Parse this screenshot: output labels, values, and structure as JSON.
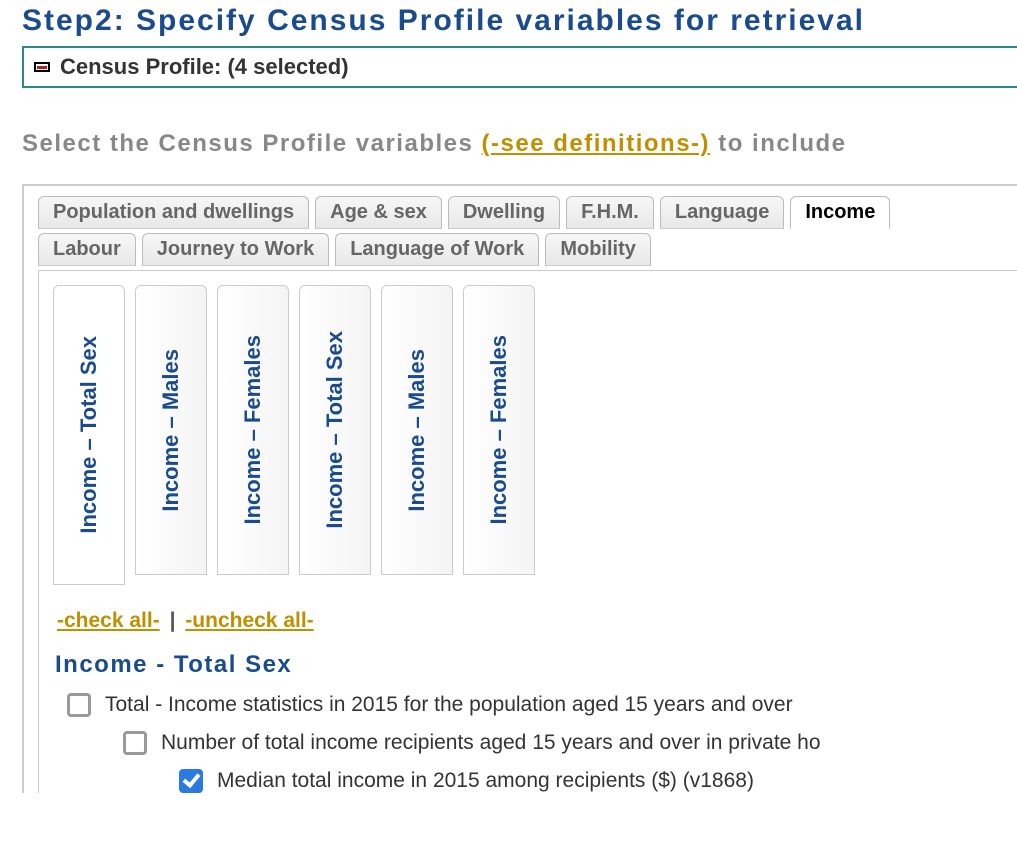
{
  "header": {
    "step_title": "Step2: Specify Census Profile variables for retrieval",
    "profile_bar_label": "Census Profile: (4 selected)"
  },
  "instruction": {
    "prefix": "Select the Census Profile variables ",
    "link": "(-see definitions-)",
    "suffix": " to include"
  },
  "tabs_row1": [
    {
      "label": "Population and dwellings",
      "active": false
    },
    {
      "label": "Age & sex",
      "active": false
    },
    {
      "label": "Dwelling",
      "active": false
    },
    {
      "label": "F.H.M.",
      "active": false
    },
    {
      "label": "Language",
      "active": false
    },
    {
      "label": "Income",
      "active": true
    }
  ],
  "tabs_row2": [
    {
      "label": "Labour",
      "active": false
    },
    {
      "label": "Journey to Work",
      "active": false
    },
    {
      "label": "Language of Work",
      "active": false
    },
    {
      "label": "Mobility",
      "active": false
    }
  ],
  "vtabs": [
    {
      "label": "Income – Total Sex",
      "active": true
    },
    {
      "label": "Income – Males",
      "active": false
    },
    {
      "label": "Income – Females",
      "active": false
    },
    {
      "label": "Income – Total Sex",
      "active": false
    },
    {
      "label": "Income – Males",
      "active": false
    },
    {
      "label": "Income – Females",
      "active": false
    }
  ],
  "check_links": {
    "check_all": "-check all-",
    "uncheck_all": "-uncheck all-",
    "separator": "|"
  },
  "section": {
    "title": "Income - Total Sex",
    "items": [
      {
        "indent": 1,
        "checked": false,
        "label": "Total - Income statistics in 2015 for the population aged 15 years and over"
      },
      {
        "indent": 2,
        "checked": false,
        "label": "Number of total income recipients aged 15 years and over in private ho"
      },
      {
        "indent": 3,
        "checked": true,
        "label": "Median total income in 2015 among recipients ($) (v1868)"
      }
    ]
  }
}
